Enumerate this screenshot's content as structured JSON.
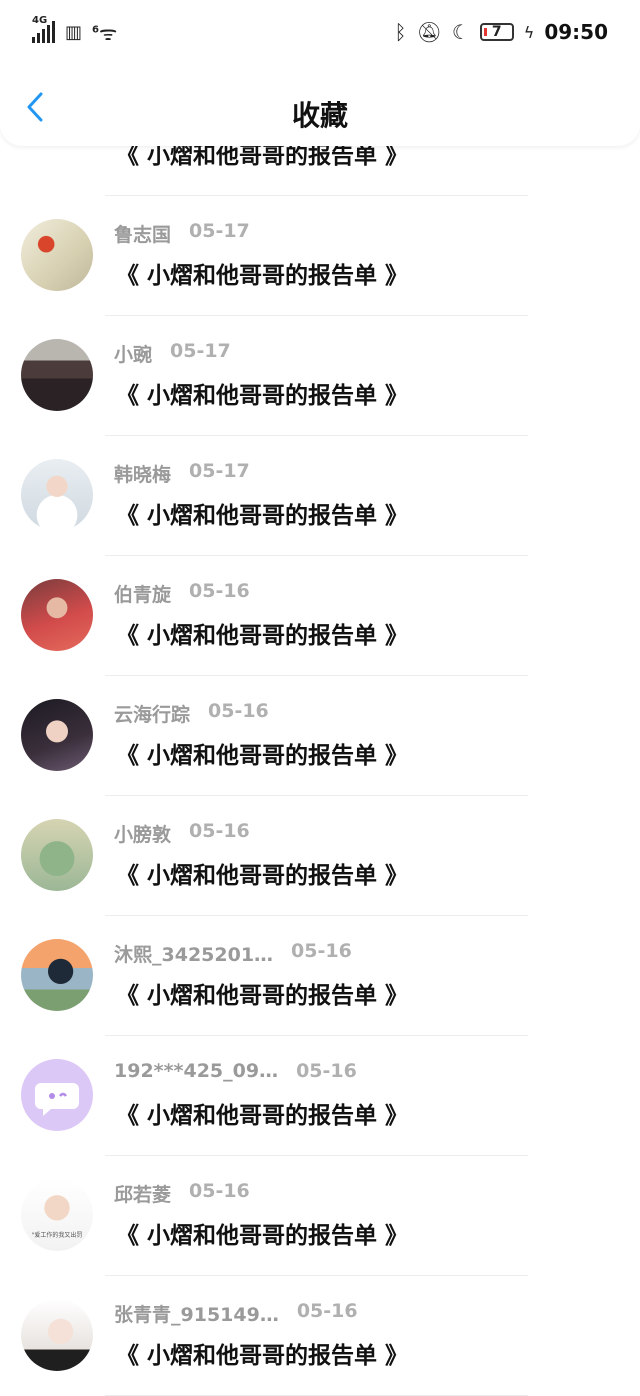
{
  "status": {
    "network": "4G",
    "wifi_label": "6",
    "battery": "7",
    "time": "09:50"
  },
  "header": {
    "title": "收藏"
  },
  "colors": {
    "accent": "#2196f3"
  },
  "list": [
    {
      "name": "",
      "date": "",
      "content": "《 小熠和他哥哥的报告单 》",
      "avatar": "partial"
    },
    {
      "name": "鲁志国",
      "date": "05-17",
      "content": "《 小熠和他哥哥的报告单 》",
      "avatar": "flower"
    },
    {
      "name": "小豌",
      "date": "05-17",
      "content": "《 小熠和他哥哥的报告单 》",
      "avatar": "group"
    },
    {
      "name": "韩晓梅",
      "date": "05-17",
      "content": "《 小熠和他哥哥的报告单 》",
      "avatar": "bride"
    },
    {
      "name": "伯青旋",
      "date": "05-16",
      "content": "《 小熠和他哥哥的报告单 》",
      "avatar": "girl-red"
    },
    {
      "name": "云海行踪",
      "date": "05-16",
      "content": "《 小熠和他哥哥的报告单 》",
      "avatar": "girl-dark"
    },
    {
      "name": "小膀敦",
      "date": "05-16",
      "content": "《 小熠和他哥哥的报告单 》",
      "avatar": "parrot"
    },
    {
      "name": "沐熙_3425201…",
      "date": "05-16",
      "content": "《 小熠和他哥哥的报告单 》",
      "avatar": "sunset"
    },
    {
      "name": "192***425_09…",
      "date": "05-16",
      "content": "《 小熠和他哥哥的报告单 》",
      "avatar": "chat-bubble"
    },
    {
      "name": "邱若菱",
      "date": "05-16",
      "content": "《 小熠和他哥哥的报告单 》",
      "avatar": "child",
      "avatar_caption": "\"爱工作的我又出罚"
    },
    {
      "name": "张青青_915149…",
      "date": "05-16",
      "content": "《 小熠和他哥哥的报告单 》",
      "avatar": "girl-white"
    }
  ]
}
